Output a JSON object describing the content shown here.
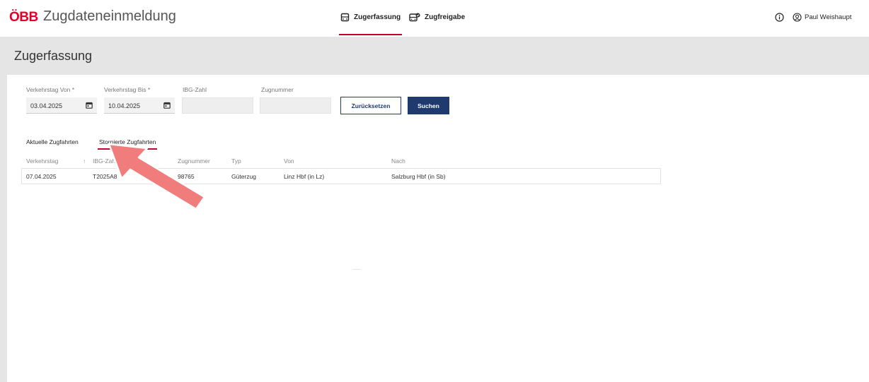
{
  "header": {
    "logo": "ÖBB",
    "app_title": "Zugdateneinmeldung",
    "nav": [
      {
        "label": "Zugerfassung",
        "icon": "train-icon",
        "active": true
      },
      {
        "label": "Zugfreigabe",
        "icon": "train-check-icon",
        "active": false
      }
    ],
    "user_name": "Paul Weishaupt"
  },
  "page": {
    "title": "Zugerfassung"
  },
  "filters": {
    "from_label": "Verkehrstag Von *",
    "from_value": "03.04.2025",
    "to_label": "Verkehrstag Bis *",
    "to_value": "10.04.2025",
    "ibg_label": "IBG-Zahl",
    "ibg_value": "",
    "train_label": "Zugnummer",
    "train_value": "",
    "reset_label": "Zurücksetzen",
    "search_label": "Suchen"
  },
  "tabs": [
    {
      "label": "Aktuelle Zugfahrten",
      "active": false
    },
    {
      "label": "Stornierte Zugfahrten",
      "active": true
    }
  ],
  "table": {
    "columns": [
      "Verkehrstag",
      "IBG-Zahl",
      "Zugnummer",
      "Typ",
      "Von",
      "Nach"
    ],
    "sort_indicator": "↑",
    "rows": [
      {
        "verkehrstag": "07.04.2025",
        "ibg": "T2025A8",
        "zugnummer": "98765",
        "typ": "Güterzug",
        "von": "Linz Hbf (in Lz)",
        "nach": "Salzburg Hbf (in Sb)"
      }
    ]
  },
  "colors": {
    "brand_red": "#e2002a",
    "underline_red": "#c3002f",
    "primary_blue": "#1f3a6e",
    "arrow": "#f07c7c"
  }
}
